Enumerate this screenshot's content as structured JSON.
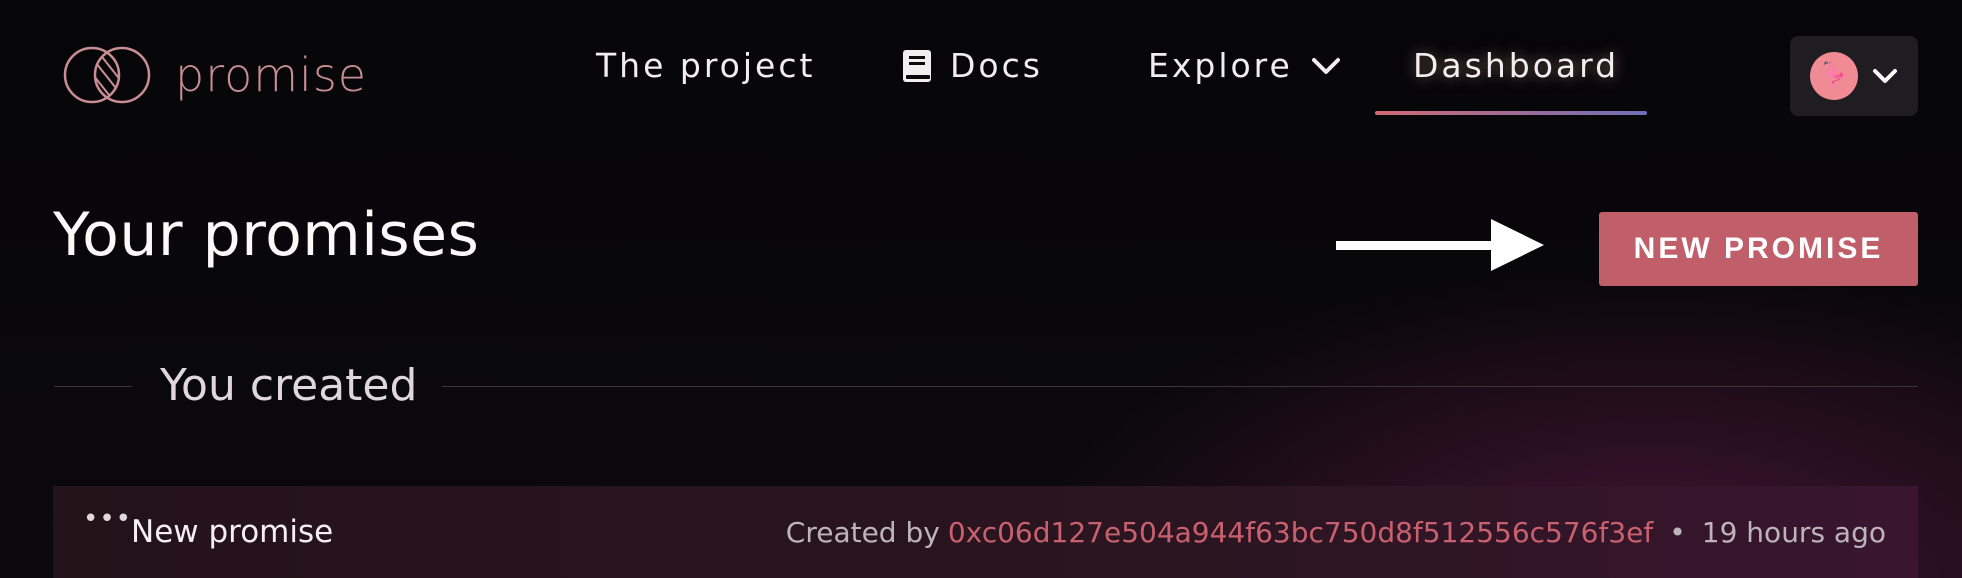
{
  "brand": {
    "name": "promise",
    "logo_icon": "overlapping-circles-logo"
  },
  "nav": {
    "project": "The project",
    "docs": "Docs",
    "explore": "Explore",
    "dashboard": "Dashboard",
    "active": "Dashboard"
  },
  "account": {
    "avatar_emoji": "🦩",
    "avatar_color": "#f08a93"
  },
  "page": {
    "title": "Your promises",
    "new_button": "NEW PROMISE",
    "section_label": "You created"
  },
  "promises": [
    {
      "title": "New promise",
      "created_by_label": "Created by",
      "address": "0xc06d127e504a944f63bc750d8f512556c576f3ef",
      "age": "19 hours ago"
    }
  ],
  "colors": {
    "accent": "#c05e69",
    "link": "#c8616d",
    "logo": "#c98e93"
  }
}
